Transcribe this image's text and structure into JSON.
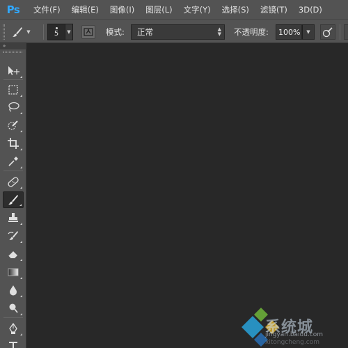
{
  "app": {
    "logo": "Ps"
  },
  "menu": {
    "items": [
      "文件(F)",
      "编辑(E)",
      "图像(I)",
      "图层(L)",
      "文字(Y)",
      "选择(S)",
      "滤镜(T)",
      "3D(D)"
    ]
  },
  "options": {
    "brush_size": "5",
    "mode_label": "模式:",
    "mode_value": "正常",
    "opacity_label": "不透明度:",
    "opacity_value": "100%"
  },
  "toolbox": {
    "collapse_glyph": "»",
    "tools": [
      "move-tool",
      "marquee-tool",
      "lasso-tool",
      "quick-selection-tool",
      "crop-tool",
      "eyedropper-tool",
      "spot-healing-brush-tool",
      "brush-tool",
      "clone-stamp-tool",
      "history-brush-tool",
      "eraser-tool",
      "gradient-tool",
      "blur-tool",
      "dodge-tool",
      "pen-tool",
      "type-tool"
    ],
    "active_tool": "brush-tool"
  },
  "watermark": {
    "text": "系统城",
    "url": "jingyan.baidu.com",
    "sub": "xitongcheng.com"
  },
  "colors": {
    "menubar": "#535353",
    "canvas": "#282828",
    "ps_blue": "#31a8ff"
  }
}
